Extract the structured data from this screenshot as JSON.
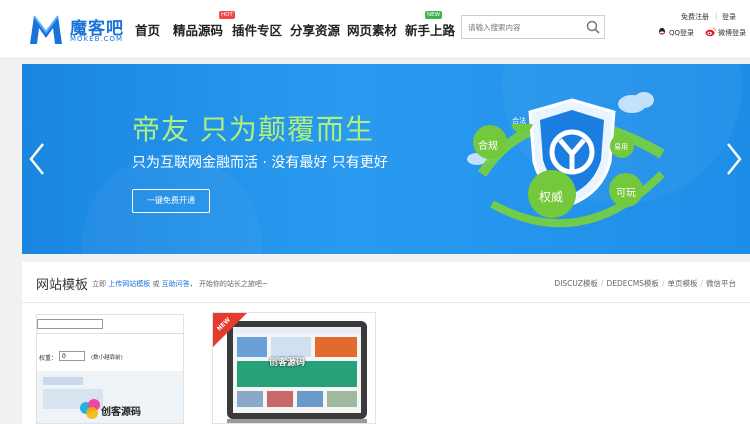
{
  "header": {
    "logo_cn": "魔客吧",
    "logo_en": "MOKEB.COM",
    "nav": [
      {
        "label": "首页"
      },
      {
        "label": "精品源码",
        "tag": "HOT"
      },
      {
        "label": "插件专区"
      },
      {
        "label": "分享资源"
      },
      {
        "label": "网页素材"
      },
      {
        "label": "新手上路",
        "tag": "NEW"
      }
    ],
    "search": {
      "placeholder": "请输入搜索内容"
    },
    "user": {
      "register": "免费注册",
      "login": "登录",
      "qq_login": "QQ登录",
      "weibo_login": "微博登录"
    }
  },
  "banner": {
    "title": "帝友 只为颠覆而生",
    "subtitle": "只为互联网金融而活 · 没有最好 只有更好",
    "button": "一键免费开通",
    "bubbles": [
      "合规",
      "合法",
      "权威",
      "可玩",
      "易用"
    ]
  },
  "section": {
    "title": "网站模板",
    "desc_prefix": "立即",
    "desc_link1": "上传网站模板",
    "desc_or": "或",
    "desc_link2": "互助问答",
    "desc_suffix": "开始你的站长之旅吧~",
    "categories": [
      "DISCUZ模板",
      "DEDECMS模板",
      "单页模板",
      "微信平台"
    ],
    "card1": {
      "field_label": "权重：",
      "field_value": "0",
      "field_note": "(数小越靠前)",
      "watermark": "创客源码"
    },
    "card2": {
      "badge": "NEW",
      "watermark": "创客源码"
    }
  },
  "colors": {
    "brand": "#1a73d9",
    "banner_bg": "#1e8de8",
    "title_green": "#aef07a",
    "hot": "#f04848",
    "new": "#3cb64a"
  }
}
